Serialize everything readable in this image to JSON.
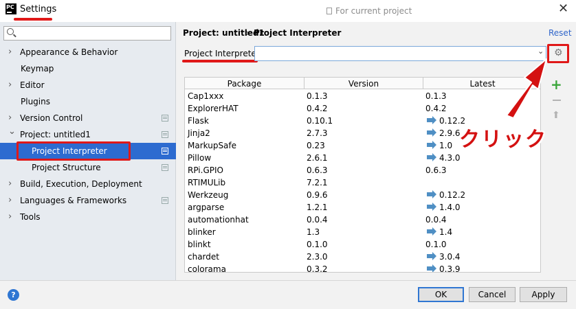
{
  "window": {
    "app_icon_text": "PC",
    "title": "Settings",
    "close_glyph": "✕"
  },
  "sidebar": {
    "search_placeholder": "",
    "items": [
      {
        "label": "Appearance & Behavior",
        "arrow": "›"
      },
      {
        "label": "Keymap"
      },
      {
        "label": "Editor",
        "arrow": "›"
      },
      {
        "label": "Plugins"
      },
      {
        "label": "Version Control",
        "arrow": "›"
      },
      {
        "label": "Project: untitled1",
        "arrow": "⌄"
      },
      {
        "label": "Project Interpreter"
      },
      {
        "label": "Project Structure"
      },
      {
        "label": "Build, Execution, Deployment",
        "arrow": "›"
      },
      {
        "label": "Languages & Frameworks",
        "arrow": "›"
      },
      {
        "label": "Tools",
        "arrow": "›"
      }
    ]
  },
  "breadcrumb": {
    "project": "Project: untitled1",
    "separator": "›",
    "page": "Project Interpreter",
    "hint": "For current project",
    "reset": "Reset"
  },
  "interpreter": {
    "label": "Project Interpreter:",
    "value": "",
    "dropdown_glyph": "⌄",
    "gear_glyph": "⚙"
  },
  "packages": {
    "columns": [
      "Package",
      "Version",
      "Latest"
    ],
    "rows": [
      {
        "name": "Cap1xxx",
        "version": "0.1.3",
        "latest": "0.1.3",
        "upgrade": false
      },
      {
        "name": "ExplorerHAT",
        "version": "0.4.2",
        "latest": "0.4.2",
        "upgrade": false
      },
      {
        "name": "Flask",
        "version": "0.10.1",
        "latest": "0.12.2",
        "upgrade": true
      },
      {
        "name": "Jinja2",
        "version": "2.7.3",
        "latest": "2.9.6",
        "upgrade": true
      },
      {
        "name": "MarkupSafe",
        "version": "0.23",
        "latest": "1.0",
        "upgrade": true
      },
      {
        "name": "Pillow",
        "version": "2.6.1",
        "latest": "4.3.0",
        "upgrade": true
      },
      {
        "name": "RPi.GPIO",
        "version": "0.6.3",
        "latest": "0.6.3",
        "upgrade": false
      },
      {
        "name": "RTIMULib",
        "version": "7.2.1",
        "latest": "",
        "upgrade": false
      },
      {
        "name": "Werkzeug",
        "version": "0.9.6",
        "latest": "0.12.2",
        "upgrade": true
      },
      {
        "name": "argparse",
        "version": "1.2.1",
        "latest": "1.4.0",
        "upgrade": true
      },
      {
        "name": "automationhat",
        "version": "0.0.4",
        "latest": "0.0.4",
        "upgrade": false
      },
      {
        "name": "blinker",
        "version": "1.3",
        "latest": "1.4",
        "upgrade": true
      },
      {
        "name": "blinkt",
        "version": "0.1.0",
        "latest": "0.1.0",
        "upgrade": false
      },
      {
        "name": "chardet",
        "version": "2.3.0",
        "latest": "3.0.4",
        "upgrade": true
      },
      {
        "name": "colorama",
        "version": "0.3.2",
        "latest": "0.3.9",
        "upgrade": true
      }
    ],
    "add_glyph": "+",
    "upgrade_side_glyph": "⬆"
  },
  "annotation": {
    "text": "クリック",
    "color": "#d41111"
  },
  "footer": {
    "help_glyph": "?",
    "ok": "OK",
    "cancel": "Cancel",
    "apply": "Apply"
  }
}
